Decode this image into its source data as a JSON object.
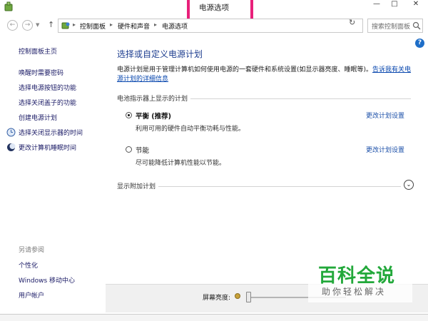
{
  "window": {
    "title": "电源选项",
    "highlight_color": "#e8207a",
    "controls": {
      "minimize": "—",
      "maximize": "□",
      "close": "✕"
    }
  },
  "address_bar": {
    "breadcrumbs": [
      "控制面板",
      "硬件和声音",
      "电源选项"
    ],
    "search_placeholder": "搜索控制面板"
  },
  "left_panel": {
    "home": "控制面板主页",
    "links": [
      {
        "label": "唤醒时需要密码",
        "icon": ""
      },
      {
        "label": "选择电源按钮的功能",
        "icon": ""
      },
      {
        "label": "选择关闭盖子的功能",
        "icon": ""
      },
      {
        "label": "创建电源计划",
        "icon": ""
      },
      {
        "label": "选择关闭显示器的时间",
        "icon": "monitor-clock-icon"
      },
      {
        "label": "更改计算机睡眠时间",
        "icon": "moon-icon"
      }
    ],
    "see_also_label": "另请参阅",
    "see_also": [
      "个性化",
      "Windows 移动中心",
      "用户帐户"
    ]
  },
  "main": {
    "title": "选择或自定义电源计划",
    "description": "电源计划是用于管理计算机如何使用电源的一套硬件和系统设置(如显示器亮度、睡眠等)。",
    "description_link": "告诉我有关电源计划的详细信息",
    "section_label": "电池指示器上显示的计划",
    "plans": [
      {
        "name": "平衡 (推荐)",
        "description": "利用可用的硬件自动平衡功耗与性能。",
        "selected": true,
        "change_link": "更改计划设置"
      },
      {
        "name": "节能",
        "description": "尽可能降低计算机性能以节能。",
        "selected": false,
        "change_link": "更改计划设置"
      }
    ],
    "extra_plans_label": "显示附加计划",
    "accent_color": "#1d3d8f"
  },
  "bottom": {
    "brightness_label": "屏幕亮度:",
    "brightness_level": 0
  },
  "watermark": {
    "title": "百科全说",
    "subtitle": "助你轻松解决",
    "color": "#22a83a"
  }
}
